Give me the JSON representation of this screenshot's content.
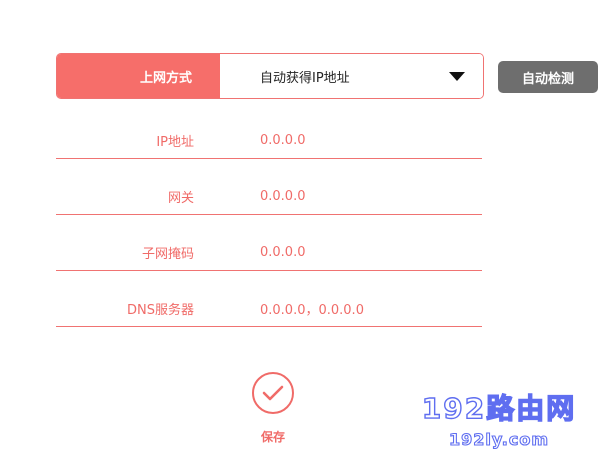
{
  "connection": {
    "label": "上网方式",
    "selected": "自动获得IP地址"
  },
  "detect_button": "自动检测",
  "fields": [
    {
      "label": "IP地址",
      "value": "0.0.0.0"
    },
    {
      "label": "网关",
      "value": "0.0.0.0"
    },
    {
      "label": "子网掩码",
      "value": "0.0.0.0"
    },
    {
      "label": "DNS服务器",
      "value": "0.0.0.0，0.0.0.0"
    }
  ],
  "save_label": "保存",
  "watermark": {
    "title": "192路由网",
    "domain": "192ly.com"
  },
  "colors": {
    "accent": "#f66e6a",
    "text_accent": "#f06b68",
    "button_gray": "#6e6e6e",
    "watermark": "#5f6ef0"
  }
}
